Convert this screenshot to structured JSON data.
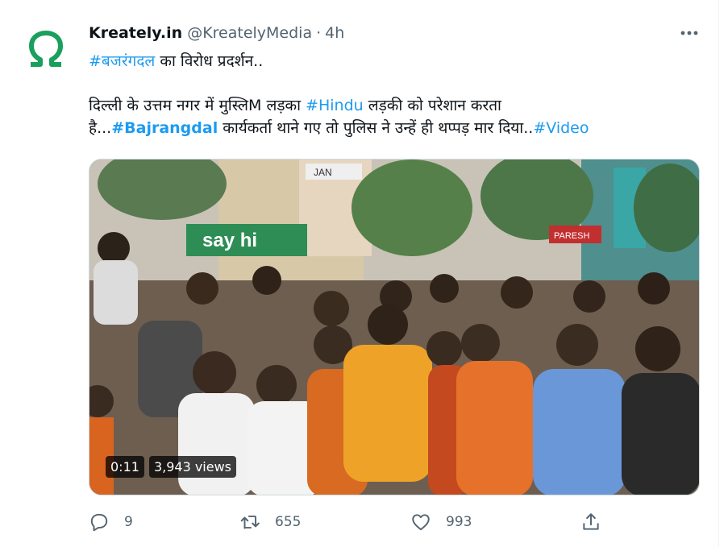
{
  "tweet": {
    "author_name": "Kreately.in",
    "handle": "@KreatelyMedia",
    "separator": "·",
    "time": "4h",
    "line1": {
      "tag": "#बजरंगदल",
      "rest": " का विरोध प्रदर्शन.."
    },
    "line2": {
      "a": "दिल्ली के उत्तम नगर में मुस्लिM लड़का ",
      "tag": "#Hindu",
      "b": " लड़की को परेशान करता"
    },
    "line3": {
      "a": "है...",
      "tag1": "#Bajrangdal",
      "b": " कार्यकर्ता थाने गए तो पुलिस ने उन्हें ही थप्पड़ मार दिया..",
      "tag2": "#Video"
    }
  },
  "media": {
    "duration": "0:11",
    "views": "3,943 views",
    "signs": {
      "shop1": "say hi",
      "shop2": "JAN",
      "shop3": "PARESH"
    }
  },
  "actions": {
    "replies": "9",
    "retweets": "655",
    "likes": "993"
  },
  "colors": {
    "accent": "#1d9bf0",
    "secondary": "#536471",
    "avatar": "#1a9f5c"
  },
  "icons": [
    "omega-avatar-icon",
    "more-icon",
    "reply-icon",
    "retweet-icon",
    "like-icon",
    "share-icon"
  ]
}
